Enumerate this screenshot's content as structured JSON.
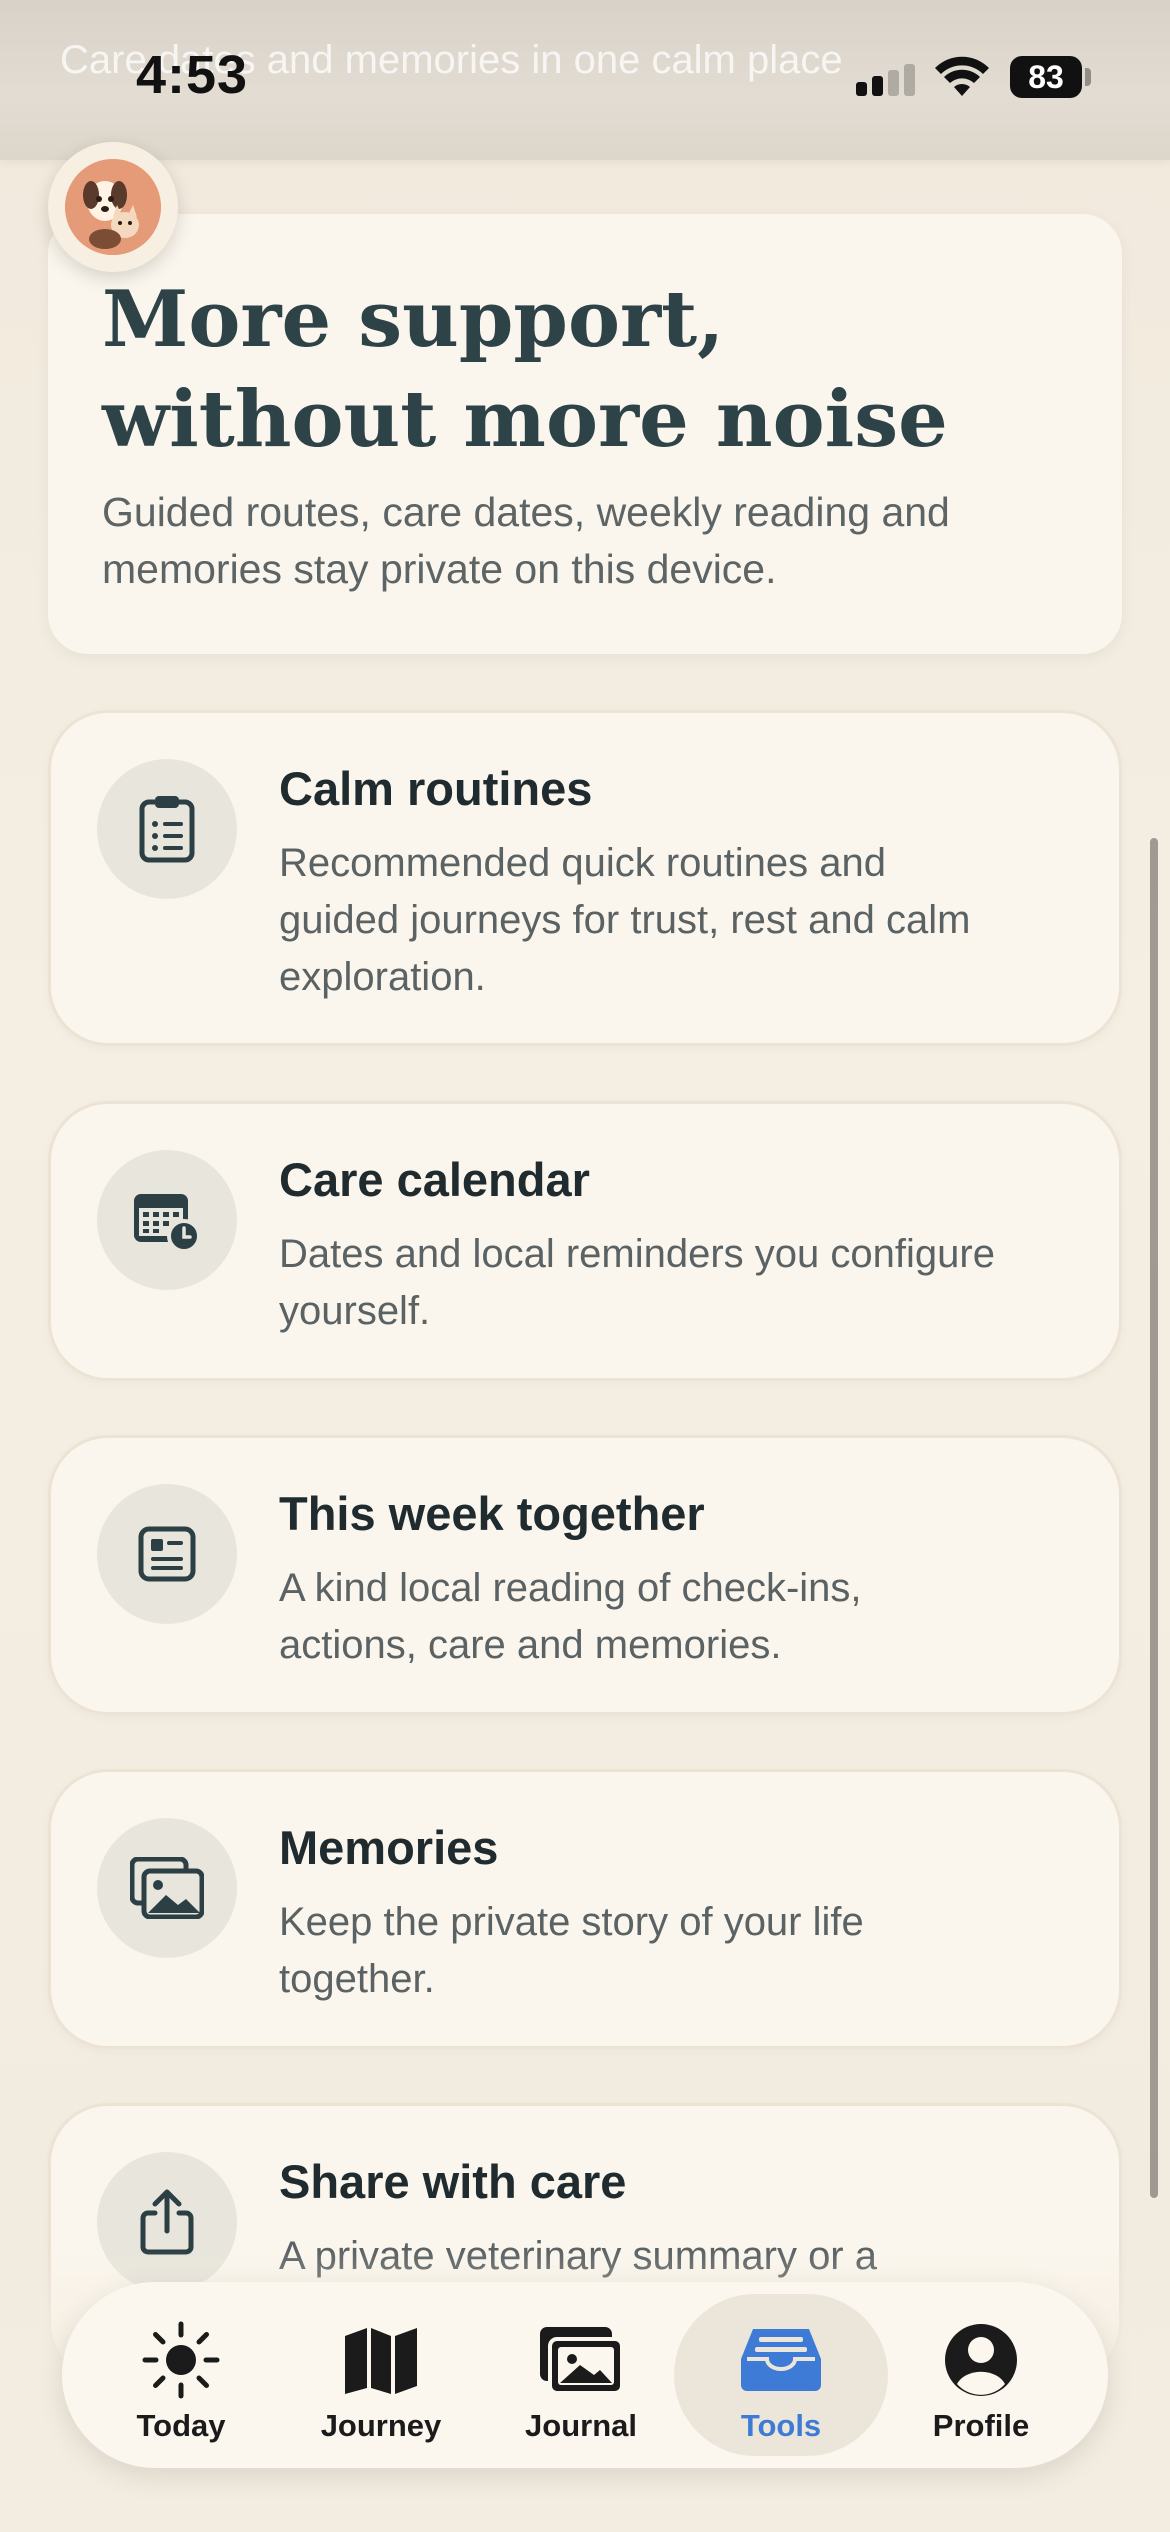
{
  "status_bar": {
    "time": "4:53",
    "battery": "83",
    "ghost_text": "Care dates and memories in one calm place"
  },
  "hero": {
    "title": "More support, without more noise",
    "subtitle": "Guided routes, care dates, weekly reading and memories stay private on this device."
  },
  "cards": [
    {
      "title": "Calm routines",
      "description": "Recommended quick routines and guided journeys for trust, rest and calm exploration.",
      "icon": "clipboard-icon"
    },
    {
      "title": "Care calendar",
      "description": "Dates and local reminders you configure yourself.",
      "icon": "calendar-clock-icon"
    },
    {
      "title": "This week together",
      "description": "A kind local reading of check-ins, actions, care and memories.",
      "icon": "weekly-summary-icon"
    },
    {
      "title": "Memories",
      "description": "Keep the private story of your life together.",
      "icon": "photos-icon"
    },
    {
      "title": "Share with care",
      "description": "A private veterinary summary or a",
      "icon": "share-icon"
    }
  ],
  "tabbar": {
    "tabs": [
      {
        "label": "Today",
        "icon": "sun-icon"
      },
      {
        "label": "Journey",
        "icon": "map-icon"
      },
      {
        "label": "Journal",
        "icon": "photo-icon"
      },
      {
        "label": "Tools",
        "icon": "tray-icon"
      },
      {
        "label": "Profile",
        "icon": "person-icon"
      }
    ],
    "active": "Tools"
  },
  "colors": {
    "background": "#f3ece0",
    "card": "#fbf6ed",
    "heading": "#2e4347",
    "accent": "#3e7bd6"
  }
}
